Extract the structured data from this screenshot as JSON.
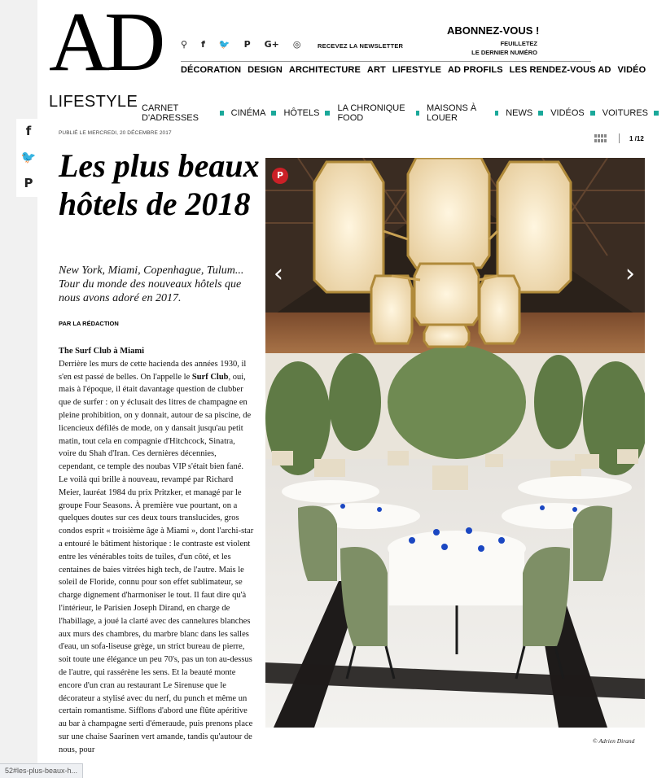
{
  "brand": {
    "logo": "AD"
  },
  "social": [
    {
      "icon": "magnifier-icon",
      "glyph": "⚲"
    },
    {
      "icon": "facebook-icon",
      "glyph": "f"
    },
    {
      "icon": "twitter-icon",
      "glyph": "🐦"
    },
    {
      "icon": "pinterest-icon",
      "glyph": "P"
    },
    {
      "icon": "google-plus-icon",
      "glyph": "G+"
    },
    {
      "icon": "instagram-icon",
      "glyph": "◎"
    }
  ],
  "header": {
    "newsletter": "RECEVEZ LA NEWSLETTER",
    "subscribe": "ABONNEZ-VOUS !",
    "browse_line1": "FEUILLETEZ",
    "browse_line2": "LE DERNIER NUMÉRO"
  },
  "main_nav": [
    "DÉCORATION",
    "DESIGN",
    "ARCHITECTURE",
    "ART",
    "LIFESTYLE",
    "AD PROFILS",
    "LES RENDEZ-VOUS AD",
    "VIDÉO"
  ],
  "section": {
    "name": "LIFESTYLE",
    "subnav": [
      "CARNET D'ADRESSES",
      "CINÉMA",
      "HÔTELS",
      "LA CHRONIQUE FOOD",
      "MAISONS À LOUER",
      "NEWS",
      "VIDÉOS",
      "VOITURES"
    ],
    "accent_color": "#1aa89a"
  },
  "share_float": [
    {
      "icon": "facebook-icon",
      "glyph": "f"
    },
    {
      "icon": "twitter-icon",
      "glyph": "🐦"
    },
    {
      "icon": "pinterest-icon",
      "glyph": "P"
    }
  ],
  "article": {
    "published": "PUBLIÉ LE MERCREDI, 20 DÉCEMBRE 2017",
    "title": "Les plus beaux hôtels de 2018",
    "subtitle": "New York, Miami, Copenhague, Tulum... Tour du monde des nouveaux hôtels que nous avons adoré en 2017.",
    "byline": "PAR LA RÉDACTION",
    "section_heading": "The Surf Club à Miami",
    "body_before": "Derrière les murs de cette hacienda des années 1930, il s'en est passé de belles. On l'appelle le ",
    "body_bold": "Surf Club",
    "body_after": ", oui, mais à l'époque, il était davantage question de clubber que de surfer : on y éclusait des litres de champagne en pleine prohibition, on y donnait, autour de sa piscine, de licencieux défilés de mode, on y dansait jusqu'au petit matin, tout cela en compagnie d'Hitchcock, Sinatra, voire du Shah d'Iran. Ces dernières décennies, cependant, ce temple des noubas VIP s'était bien fané. Le voilà qui brille à nouveau, revampé par Richard Meier, lauréat 1984 du prix Pritzker, et managé par le groupe Four Seasons. À première vue pourtant, on a quelques doutes sur ces deux tours translucides, gros condos esprit « troisième âge à Miami », dont l'archi-star a entouré le bâtiment historique : le contraste est violent entre les vénérables toits de tuiles, d'un côté, et les centaines de baies vitrées high tech, de l'autre. Mais le soleil de Floride, connu pour son effet sublimateur, se charge dignement d'harmoniser le tout. Il faut dire qu'à l'intérieur, le Parisien Joseph Dirand, en charge de l'habillage, a joué la clarté avec des cannelures blanches aux murs des chambres, du marbre blanc dans les salles d'eau, un sofa-liseuse grège, un strict bureau de pierre, soit toute une élégance un peu 70's, pas un ton au-dessus de l'autre, qui rassérène les sens. Et la beauté monte encore d'un cran au restaurant Le Sirenuse que le décorateur a stylisé avec du nerf, du punch et même un certain romantisme. Sifflons d'abord une flûte apéritive au bar à champagne serti d'émeraude, puis prenons place sur une chaise Saarinen vert amande, tandis qu'autour de nous, pour"
  },
  "gallery": {
    "counter": "1 /12",
    "pin_label": "P",
    "prev_icon": "‹",
    "next_icon": "›",
    "credit": "© Adrien Dirand"
  },
  "status_url": "52#les-plus-beaux-h..."
}
